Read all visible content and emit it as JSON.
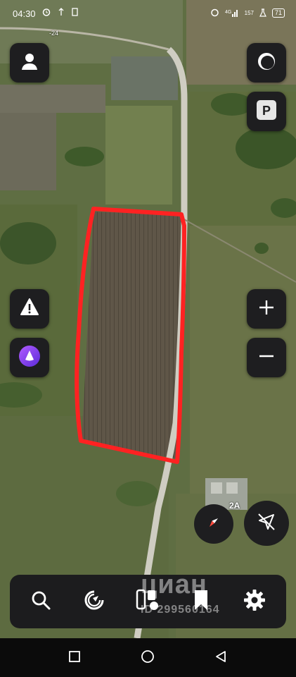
{
  "status_bar": {
    "time": "04:30",
    "network_speed": "157",
    "battery": "71"
  },
  "map": {
    "road_label": "-24",
    "field_outline_color": "#ff2222"
  },
  "controls": {
    "heading_badge": "2A"
  },
  "watermark": {
    "brand": "циан",
    "id_text": "ID 299560164"
  },
  "toolbar": {
    "items": [
      "search-icon",
      "refresh-icon",
      "route-icon",
      "bookmark-icon",
      "settings-icon"
    ]
  },
  "nav_bar": {
    "items": [
      "recents-button",
      "home-button",
      "back-button"
    ]
  }
}
